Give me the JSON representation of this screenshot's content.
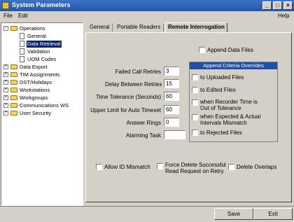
{
  "window": {
    "title": "System Parameters",
    "minimize": "_",
    "maximize": "□",
    "close": "×"
  },
  "menu": {
    "file": "File",
    "edit": "Edit",
    "help": "Help"
  },
  "tree": {
    "items": [
      {
        "label": "Operations",
        "expander": "−"
      },
      {
        "label": "General"
      },
      {
        "label": "Data Retrieval"
      },
      {
        "label": "Validation"
      },
      {
        "label": "UOM Codes"
      },
      {
        "label": "Data Export",
        "expander": "+"
      },
      {
        "label": "TIM Assignments",
        "expander": "+"
      },
      {
        "label": "DST/Holidays",
        "expander": "+"
      },
      {
        "label": "Workstations",
        "expander": "+"
      },
      {
        "label": "Workgroups",
        "expander": "+"
      },
      {
        "label": "Communications WS",
        "expander": "+"
      },
      {
        "label": "User Security",
        "expander": "+"
      }
    ]
  },
  "tabs": [
    "General",
    "Portable Readers",
    "Remote Interrogation"
  ],
  "fields": [
    {
      "label": "Failed Call Retries",
      "value": "3"
    },
    {
      "label": "Delay Between Retries",
      "value": "15"
    },
    {
      "label": "Time Tolerance (Seconds)",
      "value": "60"
    },
    {
      "label": "Upper Limit for Auto Timeset",
      "value": "60"
    },
    {
      "label": "Answer Rings",
      "value": "0"
    },
    {
      "label": "Alarming Task",
      "value": ""
    }
  ],
  "append_data_files": {
    "label": "Append Data Files",
    "checked": false
  },
  "overrides": {
    "header": "Append Criteria Overrides",
    "items": [
      {
        "label": "to Uploaded Files",
        "checked": false
      },
      {
        "label": "to Edited Files",
        "checked": false
      },
      {
        "label_line1": "when Recorder Time is",
        "label_line2": "Out of Tolerance",
        "checked": false
      },
      {
        "label_line1": "when Expected & Actual",
        "label_line2": "Intervals Mismatch",
        "checked": false
      },
      {
        "label": "to Rejected Files",
        "checked": false
      }
    ]
  },
  "bottom_checks": {
    "allow_id_mismatch": "Allow ID Mismatch",
    "force_delete_line1": "Force Delete Successful",
    "force_delete_line2": "Read Request on Retry",
    "delete_overlaps": "Delete Overlaps"
  },
  "buttons": {
    "save": "Save",
    "exit": "Exit"
  }
}
